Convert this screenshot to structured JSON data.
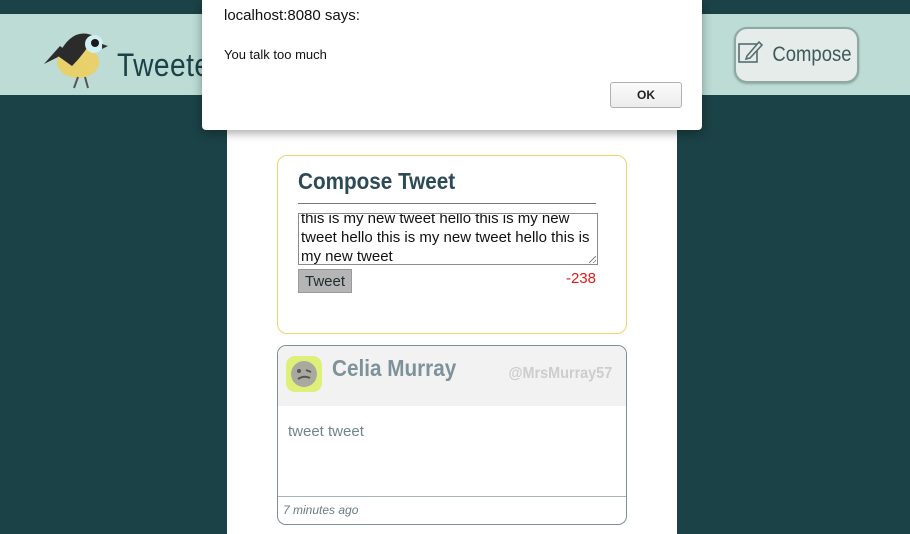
{
  "header": {
    "brand": "Tweeter",
    "compose_label": "Compose"
  },
  "compose": {
    "title": "Compose Tweet",
    "text": "this is my new tweet hello this is my new tweet hello this is my new tweet hello this is my new tweet",
    "tweet_button": "Tweet",
    "counter": "-238"
  },
  "tweet": {
    "author": "Celia Murray",
    "handle": "@MrsMurray57",
    "content": "tweet tweet",
    "time": "7 minutes ago"
  },
  "dialog": {
    "title": "localhost:8080 says:",
    "message": "You talk too much",
    "ok_label": "OK"
  },
  "colors": {
    "background": "#1b4246",
    "header": "#bcdcd5",
    "counter_negative": "#e01a1a",
    "compose_border": "#f0d36a"
  },
  "icons": {
    "logo": "bird-logo",
    "compose": "edit-icon",
    "avatar": "face-avatar"
  }
}
